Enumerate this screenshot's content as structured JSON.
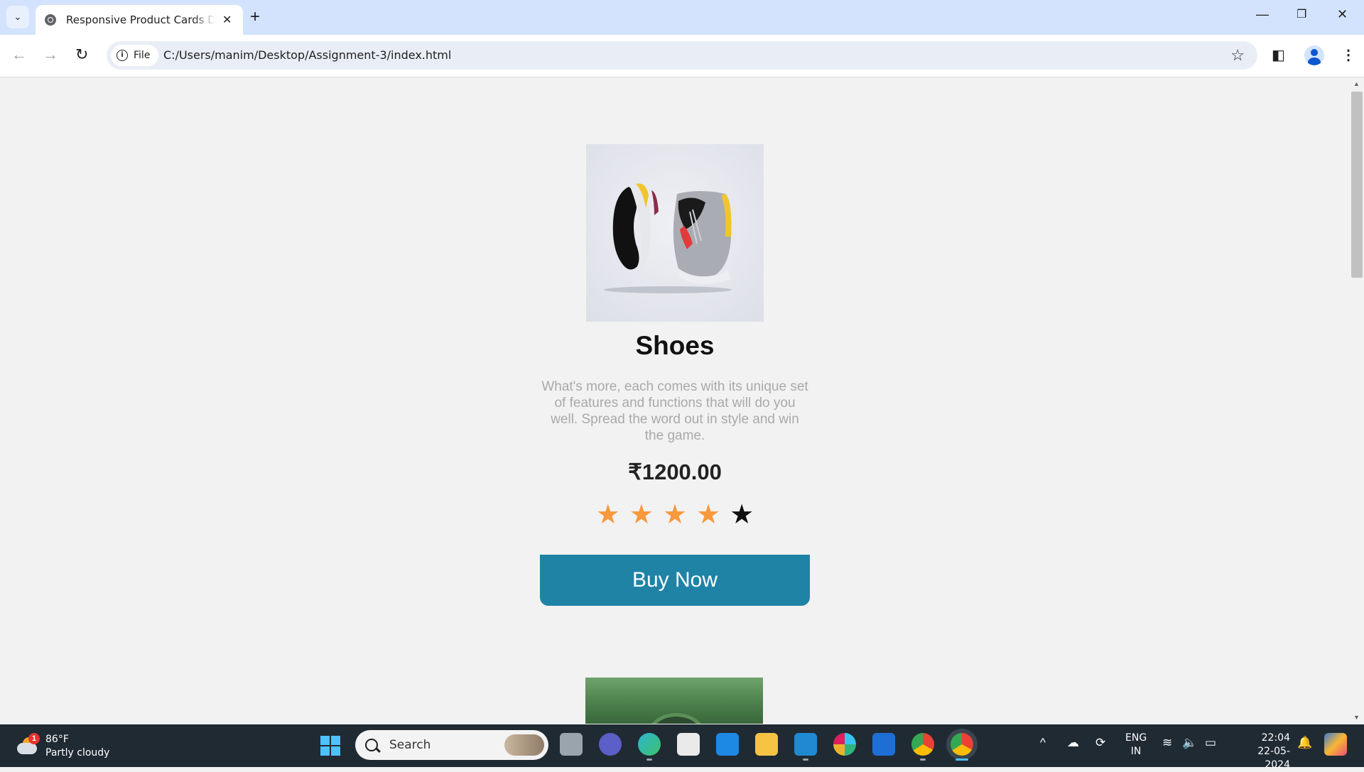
{
  "browser": {
    "tab_title": "Responsive Product Cards Design",
    "site_chip": "File",
    "url": "C:/Users/manim/Desktop/Assignment-3/index.html"
  },
  "product": {
    "name": "Shoes",
    "description": "What's more, each comes with its unique set of features and functions that will do you well. Spread the word out in style and win the game.",
    "price": "₹1200.00",
    "rating": {
      "value": 4,
      "max": 5,
      "filled_color": "#f7993c",
      "empty_color": "#111111"
    },
    "buy_label": "Buy Now",
    "button_color": "#1f83a6"
  },
  "taskbar": {
    "weather_temp": "86°F",
    "weather_desc": "Partly cloudy",
    "weather_badge": "1",
    "search_placeholder": "Search",
    "lang_top": "ENG",
    "lang_bottom": "IN",
    "time": "22:04",
    "date": "22-05-2024"
  },
  "icons": {
    "tab_list": "chevron-down-icon",
    "back": "arrow-left-icon",
    "forward": "arrow-right-icon",
    "reload": "reload-icon",
    "bookmark": "star-outline-icon",
    "sidepanel": "side-panel-icon",
    "profile": "person-icon",
    "menu": "kebab-menu-icon"
  }
}
